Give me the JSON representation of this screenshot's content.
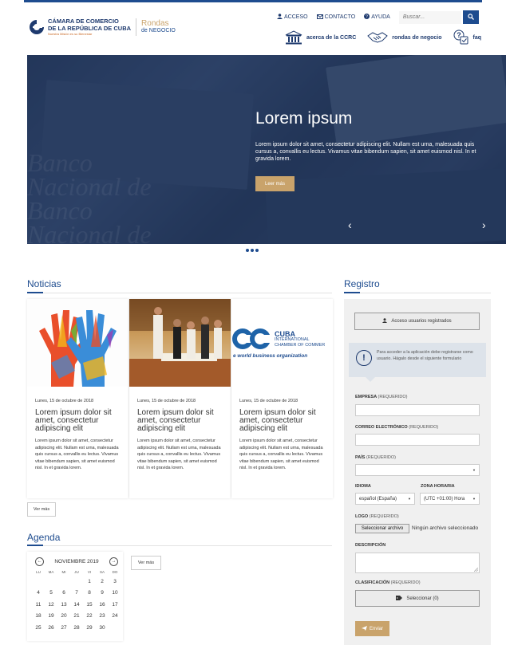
{
  "header": {
    "logo_line1": "CÁMARA DE COMERCIO",
    "logo_line2": "DE LA REPÚBLICA DE CUBA",
    "logo_tagline": "Nuestra Misión es su Bienestar",
    "rondas_line1": "Rondas",
    "rondas_line2": "de NEGOCIO",
    "nav": [
      {
        "label": "ACCESO",
        "icon": "user-icon"
      },
      {
        "label": "CONTACTO",
        "icon": "mail-icon"
      },
      {
        "label": "AYUDA",
        "icon": "help-icon"
      }
    ],
    "search_placeholder": "Buscar...",
    "subnav": [
      {
        "label": "acerca de la CCRC",
        "icon": "building-icon"
      },
      {
        "label": "rondas de negocio",
        "icon": "handshake-icon"
      },
      {
        "label": "faq",
        "icon": "faq-icon"
      }
    ]
  },
  "hero": {
    "title": "Lorem ipsum",
    "text": "Lorem ipsum dolor sit amet, consectetur adipiscing elit. Nullam est urna, malesuada quis cursus a, convallis eu lectus. Vivamus vitae bibendum sapien, sit amet euismod nisl. In et gravida lorem.",
    "button": "Leer más",
    "prev": "‹",
    "next": "›",
    "slides": 3
  },
  "news": {
    "title": "Noticias",
    "more": "Ver más",
    "cards": [
      {
        "date": "Lunes, 15 de octubre de 2018",
        "title": "Lorem ipsum dolor sit amet, consectetur adipiscing elit",
        "text": "Lorem ipsum dolor sit amet, consectetur adipiscing elit. Nullam est urna, malesuada quis cursus a, convallis eu lectus. Vivamus vitae bibendum sapien, sit amet euismod nisl. In et gravida lorem."
      },
      {
        "date": "Lunes, 15 de octubre de 2018",
        "title": "Lorem ipsum dolor sit amet, consectetur adipiscing elit",
        "text": "Lorem ipsum dolor sit amet, consectetur adipiscing elit. Nullam est urna, malesuada quis cursus a, convallis eu lectus. Vivamus vitae bibendum sapien, sit amet euismod nisl. In et gravida lorem."
      },
      {
        "date": "Lunes, 15 de octubre de 2018",
        "title": "Lorem ipsum dolor sit amet, consectetur adipiscing elit",
        "text": "Lorem ipsum dolor sit amet, consectetur adipiscing elit. Nullam est urna, malesuada quis cursus a, convallis eu lectus. Vivamus vitae bibendum sapien, sit amet euismod nisl. In et gravida lorem."
      }
    ],
    "card3_logo_main": "CUBA",
    "card3_logo_sub1": "INTERNATIONAL",
    "card3_logo_sub2": "CHAMBER OF COMMER",
    "card3_tagline": "e world business organization"
  },
  "agenda": {
    "title": "Agenda",
    "month": "NOVIEMBRE 2019",
    "more": "Ver más",
    "dow": [
      "LU",
      "MA",
      "MI",
      "JU",
      "VI",
      "SA",
      "DO"
    ],
    "days": [
      "",
      "",
      "",
      "",
      "1",
      "2",
      "3",
      "4",
      "5",
      "6",
      "7",
      "8",
      "9",
      "10",
      "11",
      "12",
      "13",
      "14",
      "15",
      "16",
      "17",
      "18",
      "19",
      "20",
      "21",
      "22",
      "23",
      "24",
      "25",
      "26",
      "27",
      "28",
      "29",
      "30",
      ""
    ]
  },
  "registro": {
    "title": "Registro",
    "login_button": "Acceso usuarios registrados",
    "notice": "Para acceder a la aplicación debe registrarse como usuario. Hágalo desde el siguiente formulario",
    "required": "(REQUERIDO)",
    "empresa_label": "EMPRESA",
    "correo_label": "CORREO ELECTRÓNICO",
    "pais_label": "PAÍS",
    "idioma_label": "IDIOMA",
    "idioma_value": "español (España)",
    "zona_label": "ZONA HORARIA",
    "zona_value": "(UTC +01:00) Hora",
    "logo_label": "LOGO",
    "file_button": "Seleccionar archivo",
    "file_none": "Ningún archivo seleccionado",
    "descripcion_label": "DESCRIPCIÓN",
    "clasificacion_label": "CLASIFICACIÓN",
    "clasificacion_button": "Seleccionar (0)",
    "submit": "Enviar"
  },
  "colors": {
    "brand_blue": "#1e4c8f",
    "accent_gold": "#c9a36b"
  }
}
